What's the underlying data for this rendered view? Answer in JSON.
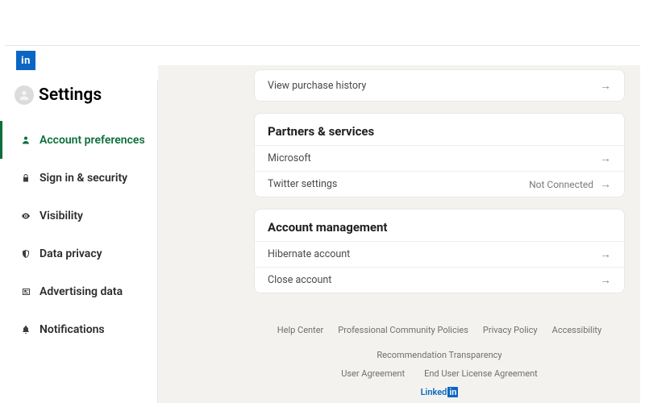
{
  "page": {
    "title": "Settings"
  },
  "sidebar": {
    "items": [
      {
        "label": "Account preferences",
        "active": true
      },
      {
        "label": "Sign in & security"
      },
      {
        "label": "Visibility"
      },
      {
        "label": "Data privacy"
      },
      {
        "label": "Advertising data"
      },
      {
        "label": "Notifications"
      }
    ]
  },
  "cards": [
    {
      "rows": [
        {
          "label": "View purchase history"
        }
      ]
    },
    {
      "title": "Partners & services",
      "rows": [
        {
          "label": "Microsoft"
        },
        {
          "label": "Twitter settings",
          "meta": "Not Connected"
        }
      ]
    },
    {
      "title": "Account management",
      "rows": [
        {
          "label": "Hibernate account"
        },
        {
          "label": "Close account"
        }
      ]
    }
  ],
  "footer": {
    "links1": [
      "Help Center",
      "Professional Community Policies",
      "Privacy Policy",
      "Accessibility",
      "Recommendation Transparency"
    ],
    "links2": [
      "User Agreement",
      "End User License Agreement"
    ]
  }
}
